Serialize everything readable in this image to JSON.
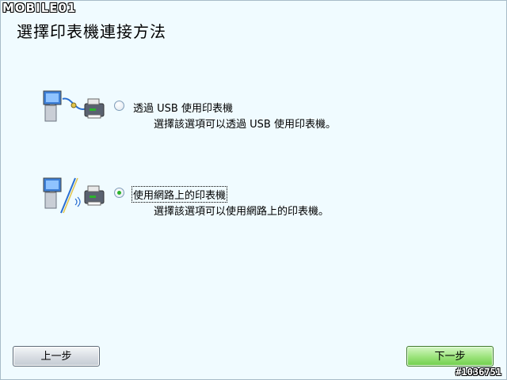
{
  "watermark": {
    "logo_text": "MOBILE01",
    "post_id": "#1036751"
  },
  "page": {
    "title": "選擇印表機連接方法"
  },
  "options": [
    {
      "label": "透過 USB 使用印表機",
      "description": "選擇該選項可以透過 USB 使用印表機。",
      "selected": false,
      "illustration_icon": "usb-connection-icon"
    },
    {
      "label": "使用網路上的印表機",
      "description": "選擇該選項可以使用網路上的印表機。",
      "selected": true,
      "illustration_icon": "network-connection-icon"
    }
  ],
  "buttons": {
    "prev_label": "上一步",
    "next_label": "下一步"
  },
  "colors": {
    "background": "#f0fbff",
    "next_button": "#8fdc6c",
    "radio_selected": "#2bb32b"
  }
}
